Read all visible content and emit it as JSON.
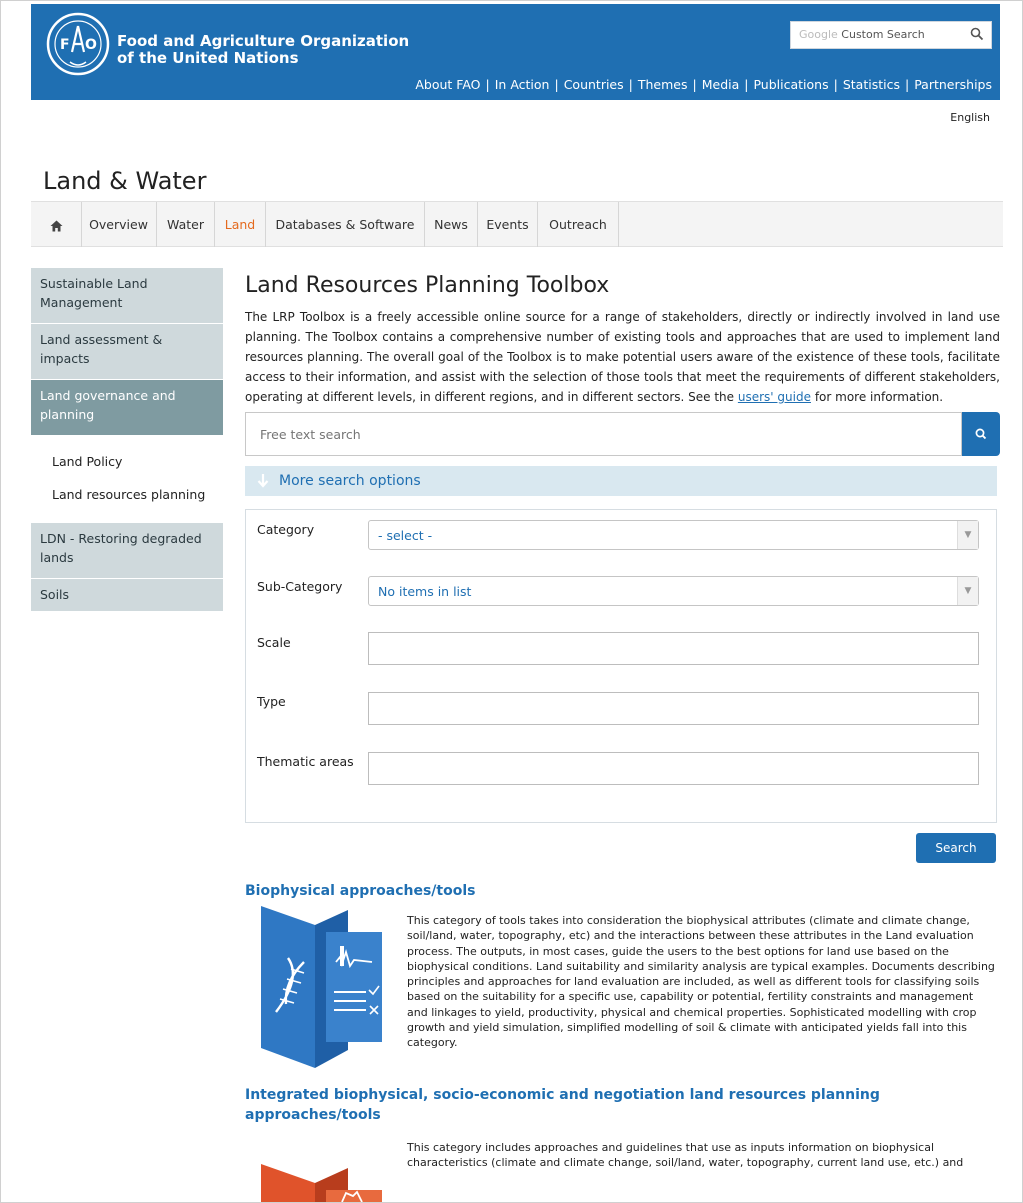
{
  "header": {
    "org_line1": "Food and Agriculture Organization",
    "org_line2": "of the United Nations",
    "search_brand": "Google",
    "search_label": "Custom Search",
    "nav": [
      "About FAO",
      "In Action",
      "Countries",
      "Themes",
      "Media",
      "Publications",
      "Statistics",
      "Partnerships"
    ]
  },
  "language": "English",
  "site_title": "Land & Water",
  "navbar": {
    "items": [
      "Overview",
      "Water",
      "Land",
      "Databases & Software",
      "News",
      "Events",
      "Outreach"
    ],
    "active": "Land"
  },
  "sidebar": {
    "items": [
      {
        "label": "Sustainable Land Management"
      },
      {
        "label": "Land assessment & impacts"
      },
      {
        "label": "Land governance and planning"
      },
      {
        "label": "LDN - Restoring degraded lands"
      },
      {
        "label": "Soils"
      }
    ],
    "subitems": [
      "Land Policy",
      "Land resources planning"
    ]
  },
  "main": {
    "title": "Land Resources Planning Toolbox",
    "intro_text": "The LRP Toolbox is a freely accessible online source for a range of stakeholders, directly or indirectly involved in land use planning. The Toolbox contains a comprehensive number of existing tools and approaches that are used to implement land resources planning. The overall goal of the Toolbox is to make potential users aware of the existence of these tools, facilitate access to their information, and assist with the selection of those tools that meet the requirements of different stakeholders, operating at different levels, in different regions, and in different sectors. See the",
    "intro_link": "users' guide",
    "intro_tail": "for more information.",
    "free_text_placeholder": "Free text search",
    "more_options": "More search options",
    "form": {
      "category_label": "Category",
      "category_value": "- select -",
      "subcategory_label": "Sub-Category",
      "subcategory_value": "No items in list",
      "scale_label": "Scale",
      "type_label": "Type",
      "thematic_label": "Thematic areas"
    },
    "search_button": "Search"
  },
  "categories": [
    {
      "title": "Biophysical approaches/tools",
      "text": "This category of tools takes into consideration the biophysical attributes (climate and climate change, soil/land, water, topography, etc) and the interactions between these attributes in the Land evaluation process. The outputs, in most cases, guide the users to the best options for land use based on the biophysical conditions. Land suitability and similarity analysis are typical examples. Documents describing principles and approaches for land evaluation are included, as well as different tools for classifying soils based on the suitability for a specific use, capability or potential, fertility constraints and management and linkages to yield, productivity, physical and chemical properties. Sophisticated modelling with crop growth and yield simulation, simplified modelling of soil & climate with anticipated yields fall into this category.",
      "icon": "dna-document-icon"
    },
    {
      "title_line1": "Integrated biophysical, socio-economic and negotiation land resources planning",
      "title_line2": "approaches/tools",
      "text": "This category includes approaches and guidelines that use as inputs information on biophysical characteristics (climate and climate change, soil/land, water, topography, current land use, etc.) and",
      "icon": "handshake-document-icon"
    }
  ],
  "colors": {
    "brand_blue": "#1f6fb2",
    "active_orange": "#e46a1e",
    "sidebar_bg": "#cfd9dc",
    "sidebar_selected": "#7f9ba1",
    "more_options_bg": "#d9e8f0",
    "icon_orange": "#e0532b"
  }
}
